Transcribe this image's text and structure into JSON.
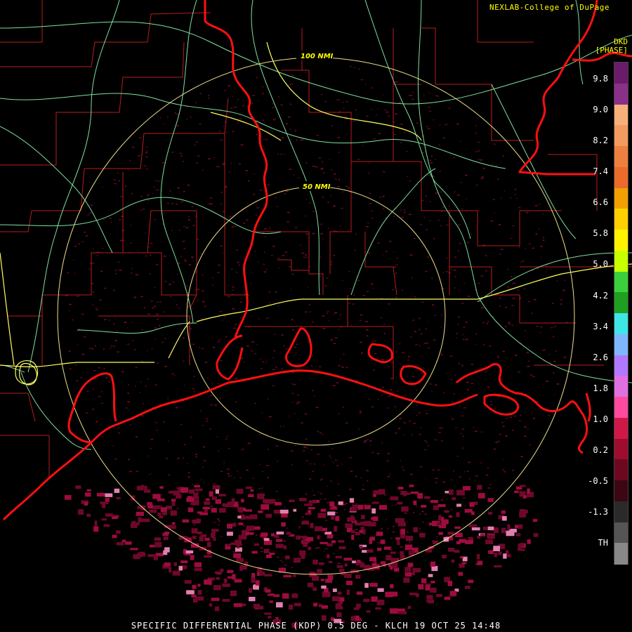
{
  "credit": "NEXLAB-College of DuPage",
  "product": {
    "code": "DKD",
    "units": "[PHASE]"
  },
  "range_rings": [
    {
      "label": "100 NMI"
    },
    {
      "label": "50 NMI"
    }
  ],
  "colorbar": {
    "labels": [
      "9.8",
      "9.0",
      "8.2",
      "7.4",
      "6.6",
      "5.8",
      "5.0",
      "4.2",
      "3.4",
      "2.6",
      "1.8",
      "1.0",
      "0.2",
      "-0.5",
      "-1.3",
      "TH"
    ],
    "colors": [
      "#6a1b6a",
      "#8a2f8a",
      "#f7b07a",
      "#f39a5f",
      "#ef7f3f",
      "#ec6a2a",
      "#f0a000",
      "#ffd000",
      "#fff200",
      "#c8ff00",
      "#3ccf3c",
      "#1f9f1f",
      "#3ee6e6",
      "#7fb7ff",
      "#b078ff",
      "#e070e0",
      "#ff4aa0",
      "#d01848",
      "#9e0c2e",
      "#6e0820",
      "#3c0612",
      "#2a2a2a",
      "#555555",
      "#888888"
    ]
  },
  "footer": "SPECIFIC DIFFERENTIAL PHASE (KDP) 0.5 DEG - KLCH 19 OCT 25 14:48",
  "colors": {
    "coastline": "#ff1010",
    "county_lines": "#b81c1c",
    "highways": "#7fe0a0",
    "interstate": "#ffff60",
    "range_ring": "#f0e08a",
    "echo": "#7a0a28"
  }
}
